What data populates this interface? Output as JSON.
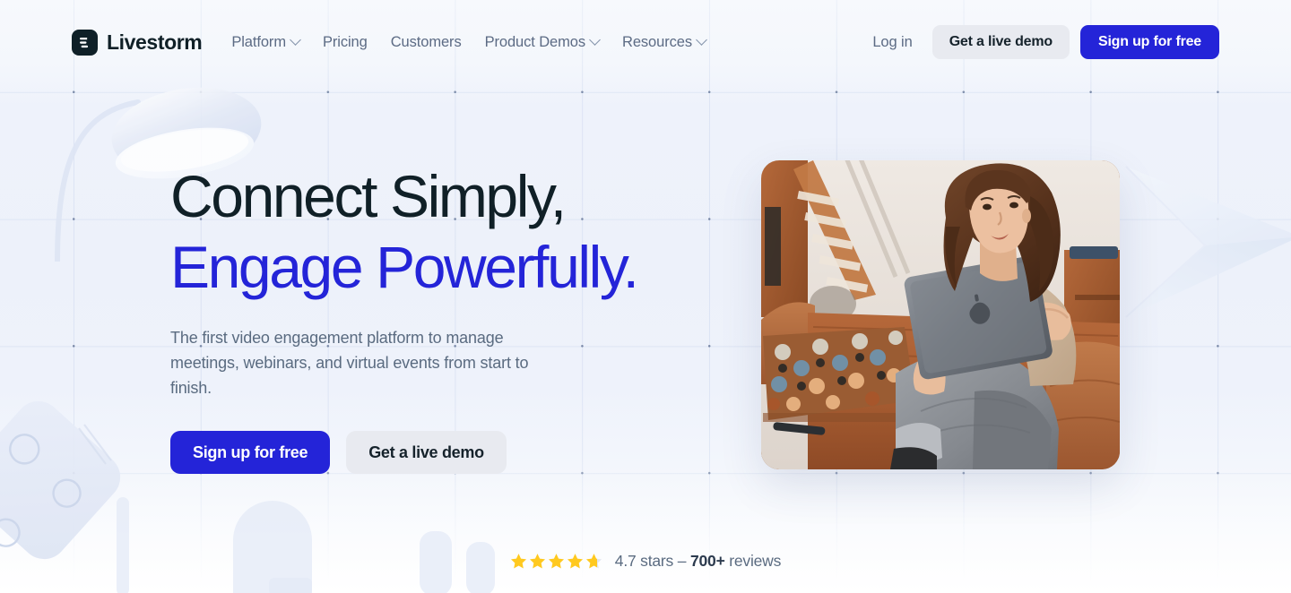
{
  "brand": {
    "name": "Livestorm",
    "logo_icon": "livestorm-mark-icon"
  },
  "header": {
    "nav": [
      {
        "label": "Platform",
        "has_dropdown": true
      },
      {
        "label": "Pricing",
        "has_dropdown": false
      },
      {
        "label": "Customers",
        "has_dropdown": false
      },
      {
        "label": "Product Demos",
        "has_dropdown": true
      },
      {
        "label": "Resources",
        "has_dropdown": true
      }
    ],
    "login_label": "Log in",
    "demo_label": "Get a live demo",
    "signup_label": "Sign up for free"
  },
  "hero": {
    "headline_line1": "Connect Simply,",
    "headline_line2": "Engage Powerfully.",
    "subhead": "The first video engagement platform to manage meetings, webinars, and virtual events from start to finish.",
    "primary_cta": "Sign up for free",
    "secondary_cta": "Get a live demo",
    "image_alt": "woman-on-couch-with-tablet-photo"
  },
  "rating": {
    "stars_filled": 4.7,
    "stars_total": 5,
    "score_text": "4.7 stars – ",
    "count_text": "700+",
    "reviews_text": " reviews"
  },
  "colors": {
    "brand_blue": "#2424d8",
    "ink": "#102027",
    "muted": "#5a6b80",
    "ghost_button": "#e8eaf0",
    "star_gold": "#ffc91f",
    "star_empty": "#e2e6ee",
    "canvas": "#eef2fb"
  },
  "decorations": {
    "lamp": "ghost-lamp-illustration",
    "pad": "ghost-pad-illustration",
    "plane": "ghost-paper-plane-illustration",
    "blobs": "ghost-blobs-illustration",
    "grid": "background-grid-pattern"
  }
}
